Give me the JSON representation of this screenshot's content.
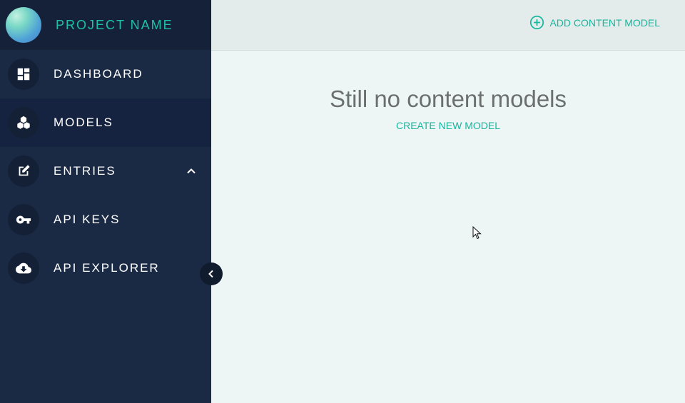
{
  "brand": {
    "name": "PROJECT NAME"
  },
  "nav": [
    {
      "label": "DASHBOARD",
      "icon": "dashboard-icon",
      "active": false
    },
    {
      "label": "MODELS",
      "icon": "cubes-icon",
      "active": true
    },
    {
      "label": "ENTRIES",
      "icon": "edit-icon",
      "active": false,
      "expanded": true
    },
    {
      "label": "API KEYS",
      "icon": "key-icon",
      "active": false
    },
    {
      "label": "API EXPLORER",
      "icon": "cloud-download-icon",
      "active": false
    }
  ],
  "toolbar": {
    "add_label": "ADD CONTENT MODEL"
  },
  "empty_state": {
    "title": "Still no content models",
    "action_label": "CREATE NEW MODEL"
  },
  "colors": {
    "sidebar": "#1b2a44",
    "accent": "#1ab59d",
    "main_bg": "#edf5f5"
  }
}
